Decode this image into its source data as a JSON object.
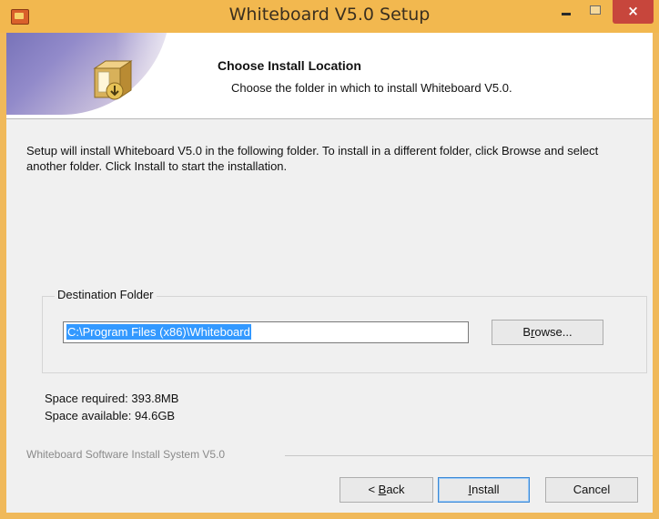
{
  "window": {
    "title": "Whiteboard V5.0 Setup",
    "close_glyph": "×",
    "icons": {
      "app": "installer-app-icon",
      "minimize": "minimize-icon",
      "maximize": "maximize-icon",
      "close": "close-icon"
    }
  },
  "header": {
    "title": "Choose Install Location",
    "subtitle": "Choose the folder in which to install Whiteboard V5.0.",
    "icon": "package-box-icon"
  },
  "body": {
    "description": "Setup will install Whiteboard V5.0 in the following folder. To install in a different folder, click Browse and select another folder. Click Install to start the installation."
  },
  "destination": {
    "group_label": "Destination Folder",
    "path_value": "C:\\Program Files (x86)\\Whiteboard",
    "browse_label_pre": "B",
    "browse_label_accel": "r",
    "browse_label_post": "owse..."
  },
  "space": {
    "required": "Space required: 393.8MB",
    "available": "Space available: 94.6GB"
  },
  "footer": {
    "brand": "Whiteboard Software Install System V5.0",
    "back_pre": "< ",
    "back_accel": "B",
    "back_post": "ack",
    "install_accel": "I",
    "install_post": "nstall",
    "cancel": "Cancel"
  },
  "colors": {
    "titlebar": "#f2b84f",
    "close_button": "#c7463c",
    "selection": "#3399ff"
  }
}
